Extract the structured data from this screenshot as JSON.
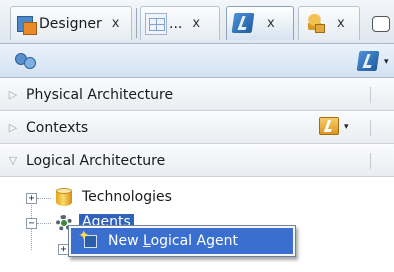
{
  "tabs": [
    {
      "label": "Designer",
      "icon": "designer-icon",
      "close": "x",
      "active": false
    },
    {
      "label": "...",
      "icon": "grid-icon",
      "close": "x",
      "active": false
    },
    {
      "label": "",
      "icon": "topology-icon",
      "close": "x",
      "active": true
    },
    {
      "label": "",
      "icon": "security-icon",
      "close": "x",
      "active": false
    }
  ],
  "toolbar": {
    "left_icon": "connect-icon",
    "right_icon": "topology-tool-icon",
    "right_caret": "▾"
  },
  "accordions": [
    {
      "label": "Physical Architecture",
      "expanded": false,
      "arrow": "▷"
    },
    {
      "label": "Contexts",
      "expanded": false,
      "arrow": "▷",
      "tool_icon": "context-tool-icon",
      "tool_caret": "▾"
    },
    {
      "label": "Logical Architecture",
      "expanded": true,
      "arrow": "▽"
    }
  ],
  "tree": {
    "nodes": [
      {
        "label": "Technologies",
        "expander": "+",
        "icon": "database-icon",
        "selected": false
      },
      {
        "label": "Agents",
        "expander": "−",
        "icon": "agent-gear-icon",
        "selected": true
      },
      {
        "label": "",
        "expander": "+",
        "icon": "",
        "selected": false
      }
    ]
  },
  "context_menu": {
    "items": [
      {
        "label_pre": "New ",
        "label_mnemonic": "L",
        "label_post": "ogical Agent",
        "icon": "new-logical-agent-icon",
        "highlighted": true
      }
    ]
  }
}
